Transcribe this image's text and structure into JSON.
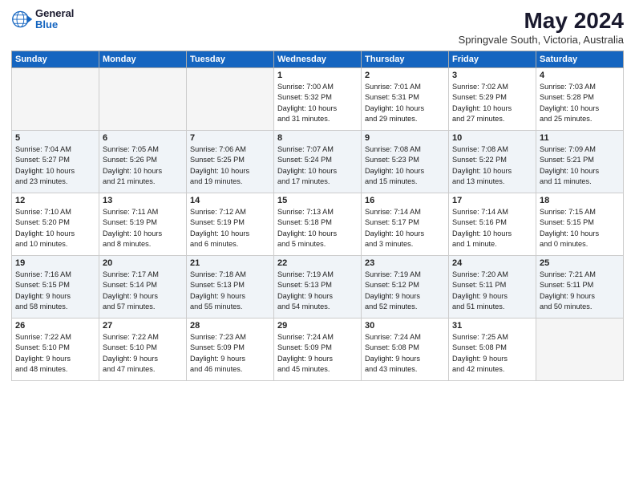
{
  "header": {
    "logo_general": "General",
    "logo_blue": "Blue",
    "month_year": "May 2024",
    "location": "Springvale South, Victoria, Australia"
  },
  "days_of_week": [
    "Sunday",
    "Monday",
    "Tuesday",
    "Wednesday",
    "Thursday",
    "Friday",
    "Saturday"
  ],
  "weeks": [
    [
      {
        "num": "",
        "info": ""
      },
      {
        "num": "",
        "info": ""
      },
      {
        "num": "",
        "info": ""
      },
      {
        "num": "1",
        "info": "Sunrise: 7:00 AM\nSunset: 5:32 PM\nDaylight: 10 hours\nand 31 minutes."
      },
      {
        "num": "2",
        "info": "Sunrise: 7:01 AM\nSunset: 5:31 PM\nDaylight: 10 hours\nand 29 minutes."
      },
      {
        "num": "3",
        "info": "Sunrise: 7:02 AM\nSunset: 5:29 PM\nDaylight: 10 hours\nand 27 minutes."
      },
      {
        "num": "4",
        "info": "Sunrise: 7:03 AM\nSunset: 5:28 PM\nDaylight: 10 hours\nand 25 minutes."
      }
    ],
    [
      {
        "num": "5",
        "info": "Sunrise: 7:04 AM\nSunset: 5:27 PM\nDaylight: 10 hours\nand 23 minutes."
      },
      {
        "num": "6",
        "info": "Sunrise: 7:05 AM\nSunset: 5:26 PM\nDaylight: 10 hours\nand 21 minutes."
      },
      {
        "num": "7",
        "info": "Sunrise: 7:06 AM\nSunset: 5:25 PM\nDaylight: 10 hours\nand 19 minutes."
      },
      {
        "num": "8",
        "info": "Sunrise: 7:07 AM\nSunset: 5:24 PM\nDaylight: 10 hours\nand 17 minutes."
      },
      {
        "num": "9",
        "info": "Sunrise: 7:08 AM\nSunset: 5:23 PM\nDaylight: 10 hours\nand 15 minutes."
      },
      {
        "num": "10",
        "info": "Sunrise: 7:08 AM\nSunset: 5:22 PM\nDaylight: 10 hours\nand 13 minutes."
      },
      {
        "num": "11",
        "info": "Sunrise: 7:09 AM\nSunset: 5:21 PM\nDaylight: 10 hours\nand 11 minutes."
      }
    ],
    [
      {
        "num": "12",
        "info": "Sunrise: 7:10 AM\nSunset: 5:20 PM\nDaylight: 10 hours\nand 10 minutes."
      },
      {
        "num": "13",
        "info": "Sunrise: 7:11 AM\nSunset: 5:19 PM\nDaylight: 10 hours\nand 8 minutes."
      },
      {
        "num": "14",
        "info": "Sunrise: 7:12 AM\nSunset: 5:19 PM\nDaylight: 10 hours\nand 6 minutes."
      },
      {
        "num": "15",
        "info": "Sunrise: 7:13 AM\nSunset: 5:18 PM\nDaylight: 10 hours\nand 5 minutes."
      },
      {
        "num": "16",
        "info": "Sunrise: 7:14 AM\nSunset: 5:17 PM\nDaylight: 10 hours\nand 3 minutes."
      },
      {
        "num": "17",
        "info": "Sunrise: 7:14 AM\nSunset: 5:16 PM\nDaylight: 10 hours\nand 1 minute."
      },
      {
        "num": "18",
        "info": "Sunrise: 7:15 AM\nSunset: 5:15 PM\nDaylight: 10 hours\nand 0 minutes."
      }
    ],
    [
      {
        "num": "19",
        "info": "Sunrise: 7:16 AM\nSunset: 5:15 PM\nDaylight: 9 hours\nand 58 minutes."
      },
      {
        "num": "20",
        "info": "Sunrise: 7:17 AM\nSunset: 5:14 PM\nDaylight: 9 hours\nand 57 minutes."
      },
      {
        "num": "21",
        "info": "Sunrise: 7:18 AM\nSunset: 5:13 PM\nDaylight: 9 hours\nand 55 minutes."
      },
      {
        "num": "22",
        "info": "Sunrise: 7:19 AM\nSunset: 5:13 PM\nDaylight: 9 hours\nand 54 minutes."
      },
      {
        "num": "23",
        "info": "Sunrise: 7:19 AM\nSunset: 5:12 PM\nDaylight: 9 hours\nand 52 minutes."
      },
      {
        "num": "24",
        "info": "Sunrise: 7:20 AM\nSunset: 5:11 PM\nDaylight: 9 hours\nand 51 minutes."
      },
      {
        "num": "25",
        "info": "Sunrise: 7:21 AM\nSunset: 5:11 PM\nDaylight: 9 hours\nand 50 minutes."
      }
    ],
    [
      {
        "num": "26",
        "info": "Sunrise: 7:22 AM\nSunset: 5:10 PM\nDaylight: 9 hours\nand 48 minutes."
      },
      {
        "num": "27",
        "info": "Sunrise: 7:22 AM\nSunset: 5:10 PM\nDaylight: 9 hours\nand 47 minutes."
      },
      {
        "num": "28",
        "info": "Sunrise: 7:23 AM\nSunset: 5:09 PM\nDaylight: 9 hours\nand 46 minutes."
      },
      {
        "num": "29",
        "info": "Sunrise: 7:24 AM\nSunset: 5:09 PM\nDaylight: 9 hours\nand 45 minutes."
      },
      {
        "num": "30",
        "info": "Sunrise: 7:24 AM\nSunset: 5:08 PM\nDaylight: 9 hours\nand 43 minutes."
      },
      {
        "num": "31",
        "info": "Sunrise: 7:25 AM\nSunset: 5:08 PM\nDaylight: 9 hours\nand 42 minutes."
      },
      {
        "num": "",
        "info": ""
      }
    ]
  ]
}
